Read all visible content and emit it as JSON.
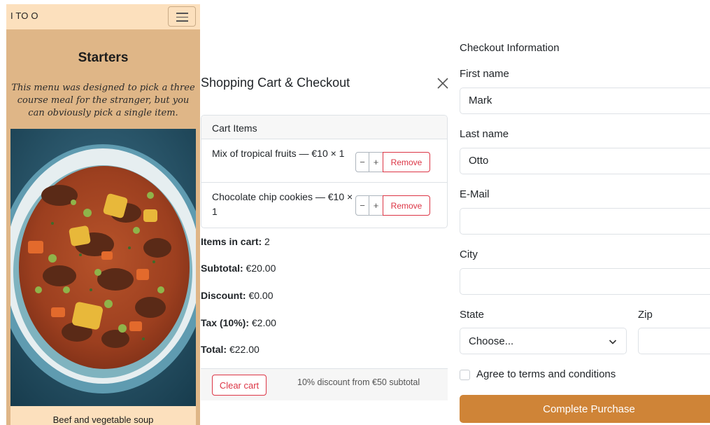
{
  "colors": {
    "menu_background": "#dfb687",
    "navbar_background": "#fce0bd",
    "danger": "#dc3545",
    "accent_button": "#cf8437",
    "border": "#dee2e6"
  },
  "menu_page": {
    "brand": "I TO O",
    "toggle_icon": "hamburger-icon",
    "title": "Starters",
    "description": "This menu was designed to pick a three course meal for the stranger, but you can obviously pick a single item.",
    "dish_caption": "Beef and vegetable soup"
  },
  "cart": {
    "title": "Shopping Cart & Checkout",
    "close_icon": "close-icon",
    "items_header": "Cart Items",
    "items": [
      {
        "text": "Mix of tropical fruits — €10 × 1",
        "minus": "−",
        "plus": "+",
        "remove": "Remove"
      },
      {
        "text": "Chocolate chip cookies — €10 × 1",
        "minus": "−",
        "plus": "+",
        "remove": "Remove"
      }
    ],
    "summary": {
      "items_in_cart_label": "Items in cart:",
      "items_in_cart_value": "2",
      "subtotal_label": "Subtotal:",
      "subtotal_value": "€20.00",
      "discount_label": "Discount:",
      "discount_value": "€0.00",
      "tax_label": "Tax (10%):",
      "tax_value": "€2.00",
      "total_label": "Total:",
      "total_value": "€22.00"
    },
    "clear_button": "Clear cart",
    "discount_note": "10% discount from €50 subtotal"
  },
  "checkout": {
    "heading": "Checkout Information",
    "first_name_label": "First name",
    "first_name_value": "Mark",
    "last_name_label": "Last name",
    "last_name_value": "Otto",
    "email_label": "E-Mail",
    "email_value": "",
    "city_label": "City",
    "city_value": "",
    "state_label": "State",
    "state_selected": "Choose...",
    "zip_label": "Zip",
    "zip_value": "",
    "terms_label": "Agree to terms and conditions",
    "submit_button": "Complete Purchase"
  }
}
